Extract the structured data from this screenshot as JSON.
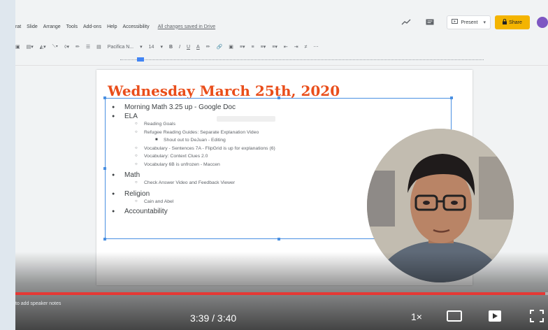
{
  "menu": {
    "items": [
      "rat",
      "Slide",
      "Arrange",
      "Tools",
      "Add-ons",
      "Help",
      "Accessibility"
    ],
    "saved_status": "All changes saved in Drive"
  },
  "header": {
    "present_label": "Present",
    "share_label": "Share"
  },
  "toolbar": {
    "font_name": "Pacifica N...",
    "font_size": "14"
  },
  "slide": {
    "title": "Wednesday March 25th, 2020",
    "bullets": [
      {
        "level": 1,
        "text": "Morning Math 3.25 up - Google Doc"
      },
      {
        "level": 1,
        "text": "ELA"
      },
      {
        "level": 2,
        "text": "Reading Goals"
      },
      {
        "level": 2,
        "text": "Refugee Reading Guides: Separate Explanation Video"
      },
      {
        "level": 3,
        "text": "Shout out to DeJuan - Editing"
      },
      {
        "level": 2,
        "text": "Vocabulary - Sentences 7A - FlipGrid is up for explanations (6)"
      },
      {
        "level": 2,
        "text": "Vocabulary: Context Clues 2.0"
      },
      {
        "level": 2,
        "text": "Vocabulary 6B is unfrozen - Maccen"
      },
      {
        "level": 1,
        "text": "Math"
      },
      {
        "level": 2,
        "text": "Check Answer Video and Feedback Viewer"
      },
      {
        "level": 1,
        "text": "Religion"
      },
      {
        "level": 2,
        "text": "Cain and Abel"
      },
      {
        "level": 1,
        "text": "Accountability"
      }
    ]
  },
  "player": {
    "speaker_notes": "to add speaker notes",
    "time_display": "3:39 / 3:40",
    "speed": "1×",
    "progress_fraction": 0.995,
    "progress_color": "#e53935"
  },
  "icons": {
    "trend": "trend-icon",
    "comments": "comments-icon",
    "present": "present-icon",
    "lock": "lock-icon",
    "theater": "theater-mode-icon",
    "miniplayer": "miniplayer-icon",
    "fullscreen": "fullscreen-icon"
  },
  "colors": {
    "title": "#e94e1b",
    "share": "#f4b400",
    "selection": "#4a90e2"
  }
}
